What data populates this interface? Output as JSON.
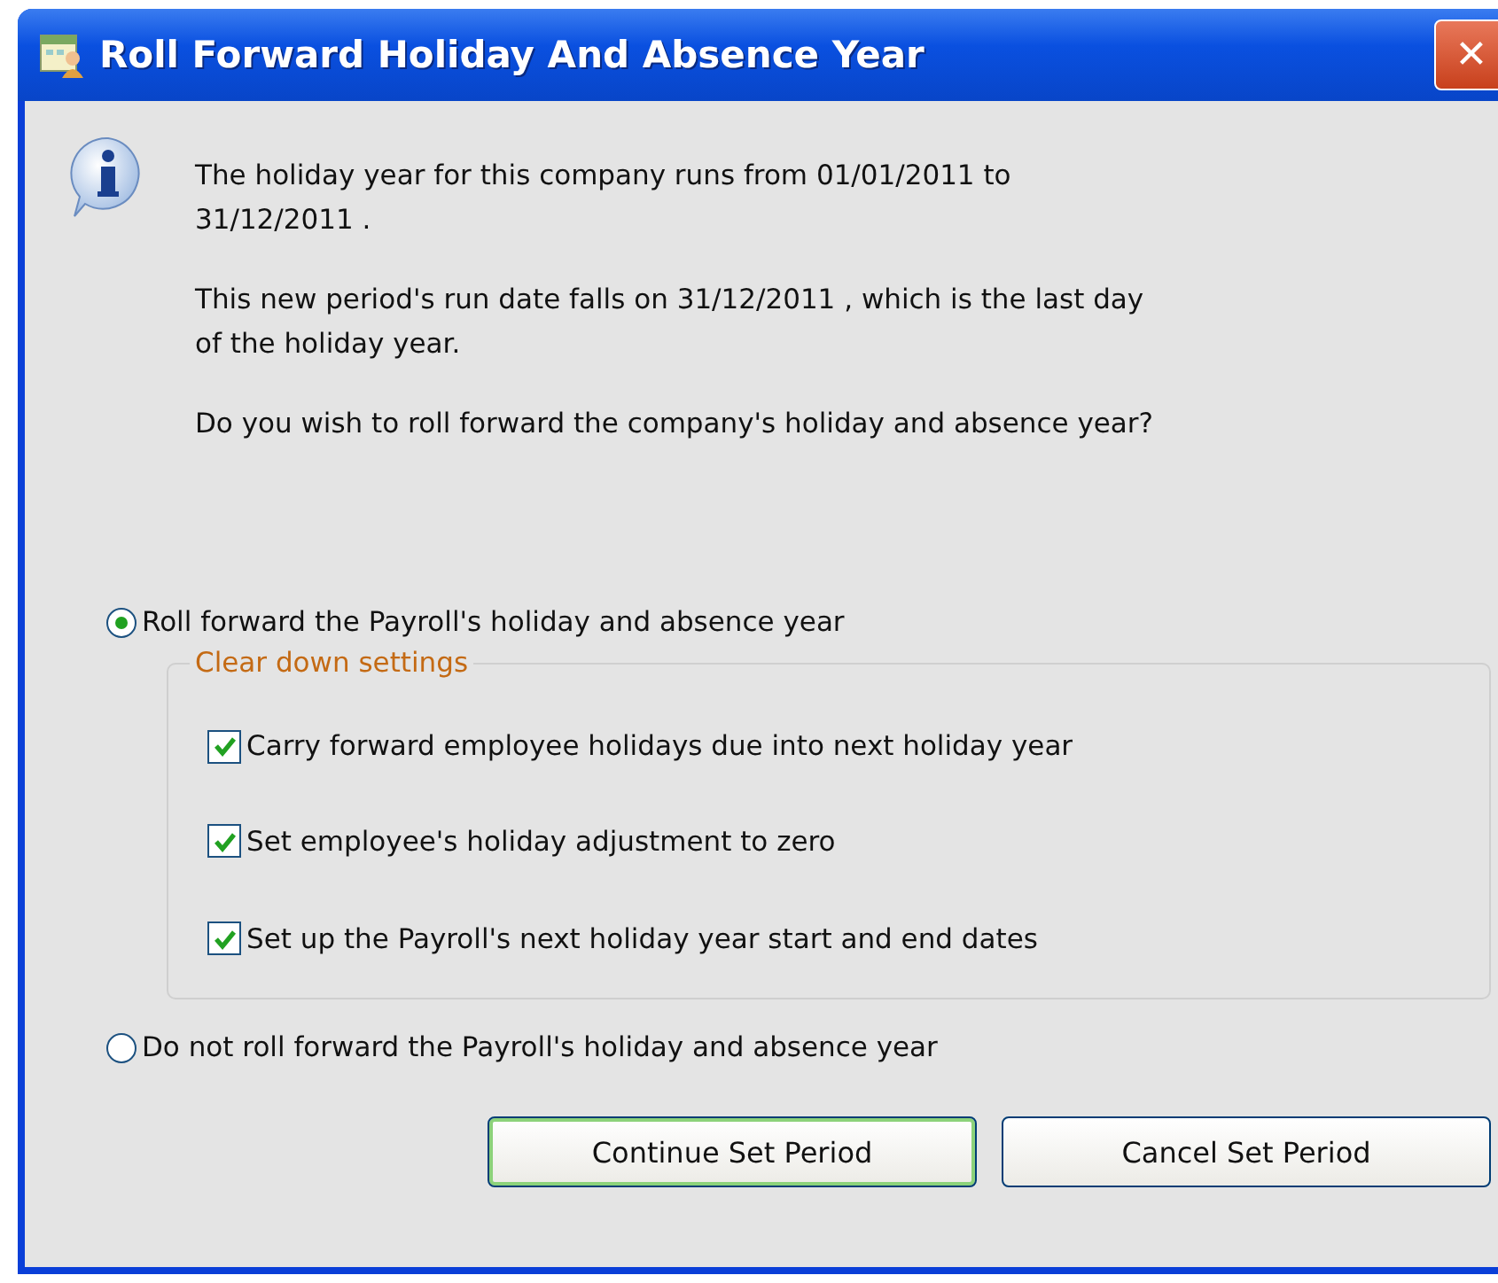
{
  "window": {
    "title": "Roll Forward Holiday And Absence Year",
    "close": "✕"
  },
  "message": [
    {
      "lines": [
        "The holiday year for this company runs from 01/01/2011 to",
        "31/12/2011 ."
      ]
    },
    {
      "lines": [
        "This new period's run date falls on 31/12/2011 , which is the last day",
        "of the holiday year."
      ]
    },
    {
      "lines": [
        "Do you wish to roll forward the company's holiday and absence year?"
      ]
    }
  ],
  "roll_option": {
    "label": "Roll forward the Payroll's holiday and absence year",
    "selected": true
  },
  "clear_down": {
    "title": "Clear down settings",
    "items": [
      {
        "label": "Carry forward employee holidays due into next holiday year",
        "checked": true
      },
      {
        "label": "Set employee's holiday adjustment to zero",
        "checked": true
      },
      {
        "label": "Set up the Payroll's next holiday year start and end dates",
        "checked": true
      }
    ]
  },
  "no_roll_option": {
    "label": "Do not roll forward the Payroll's holiday and absence year",
    "selected": false
  },
  "buttons": [
    {
      "label": "Continue Set Period",
      "default": true
    },
    {
      "label": "Cancel Set Period",
      "default": false
    }
  ]
}
